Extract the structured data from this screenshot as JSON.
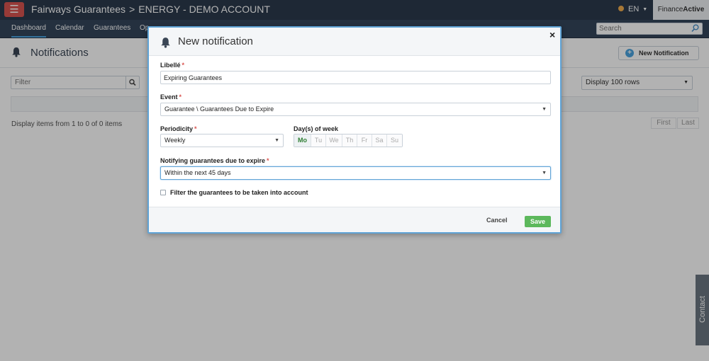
{
  "app": {
    "menu_icon": "hamburger-icon",
    "breadcrumb": {
      "parent": "Fairways Guarantees",
      "separator": ">",
      "current": "ENERGY - DEMO ACCOUNT"
    },
    "language": "EN",
    "brand": {
      "normal": "Finance",
      "bold": "Active"
    }
  },
  "nav": {
    "items": [
      "Dashboard",
      "Calendar",
      "Guarantees",
      "Op"
    ],
    "active": "Dashboard",
    "search_placeholder": "Search"
  },
  "page": {
    "title": "Notifications",
    "new_button": "New Notification",
    "filter_placeholder": "Filter",
    "rows_select": "Display 100 rows",
    "items_info": "Display items from 1 to 0 of 0 items",
    "pager": {
      "first": "First",
      "last": "Last"
    },
    "contact": "Contact"
  },
  "modal": {
    "title": "New notification",
    "close": "×",
    "libelle": {
      "label": "Libellé",
      "required": "*",
      "value": "Expiring Guarantees"
    },
    "event": {
      "label": "Event",
      "required": "*",
      "value": "Guarantee \\ Guarantees Due to Expire"
    },
    "periodicity": {
      "label": "Periodicity",
      "required": "*",
      "value": "Weekly"
    },
    "days": {
      "label": "Day(s) of week",
      "items": [
        "Mo",
        "Tu",
        "We",
        "Th",
        "Fr",
        "Sa",
        "Su"
      ],
      "selected": [
        "Mo"
      ]
    },
    "notifying": {
      "label": "Notifying guarantees due to expire",
      "required": "*",
      "value": "Within the next 45 days"
    },
    "filter_checkbox": {
      "label": "Filter the guarantees to be taken into account",
      "checked": false
    },
    "cancel": "Cancel",
    "save": "Save"
  },
  "colors": {
    "topbar": "#2b3a4d",
    "navbar": "#34465b",
    "accent": "#4aa3df",
    "danger": "#d9534f",
    "save": "#5cb85c",
    "modal_border": "#5fa3d6"
  }
}
